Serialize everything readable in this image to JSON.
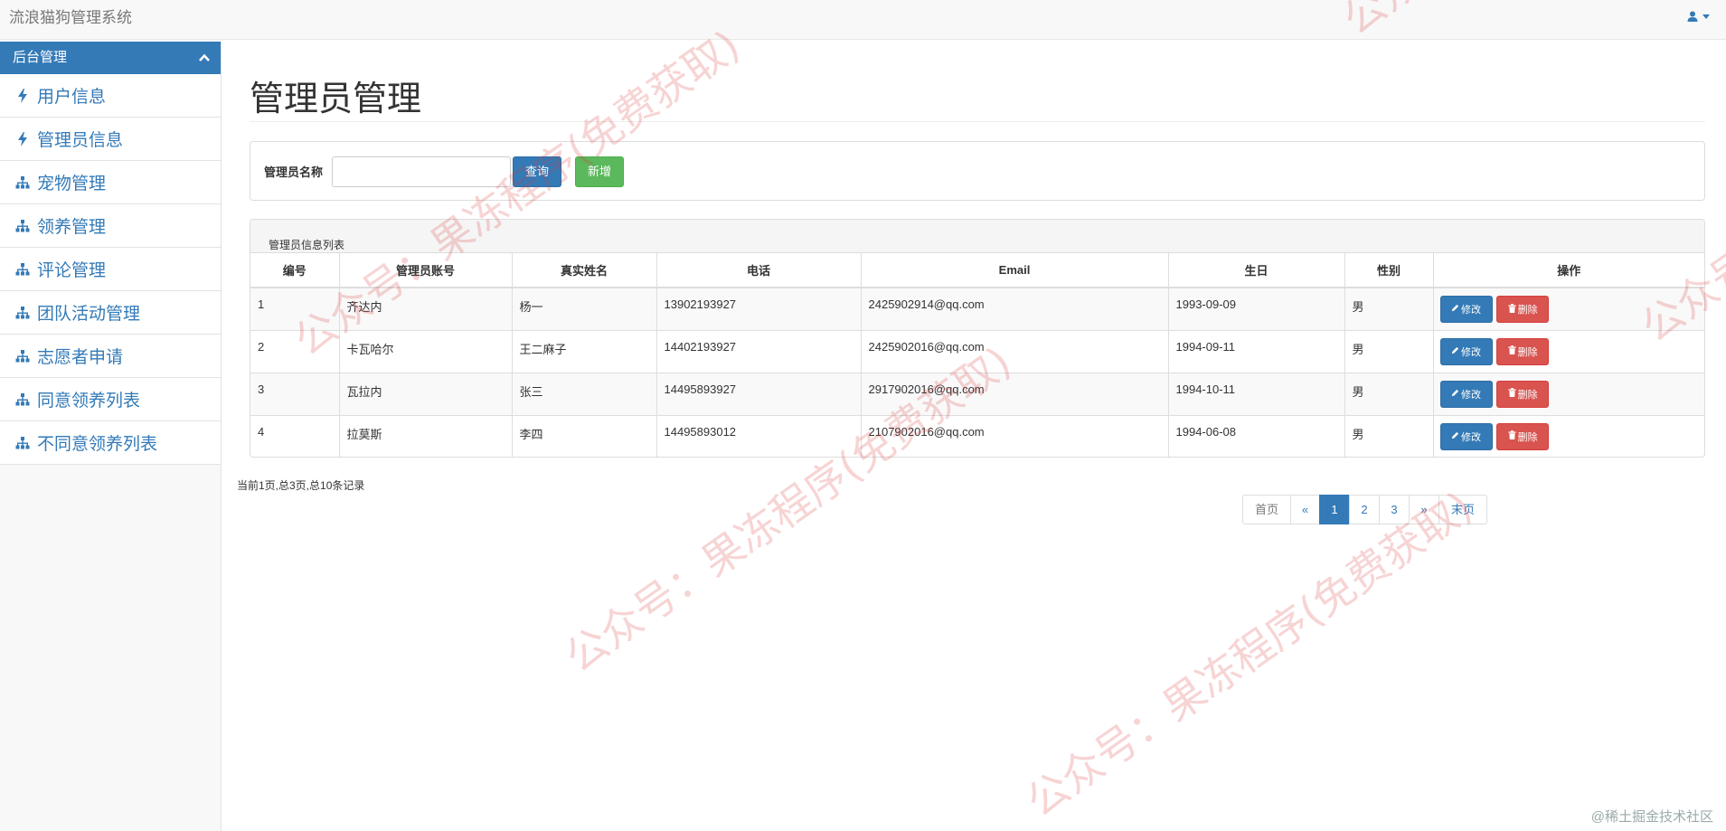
{
  "navbar": {
    "brand": "流浪猫狗管理系统",
    "user_icon": "user-icon"
  },
  "sidebar": {
    "header": "后台管理",
    "items": [
      {
        "label": "用户信息",
        "icon": "bolt-icon"
      },
      {
        "label": "管理员信息",
        "icon": "bolt-icon"
      },
      {
        "label": "宠物管理",
        "icon": "sitemap-icon"
      },
      {
        "label": "领养管理",
        "icon": "sitemap-icon"
      },
      {
        "label": "评论管理",
        "icon": "sitemap-icon"
      },
      {
        "label": "团队活动管理",
        "icon": "sitemap-icon"
      },
      {
        "label": "志愿者申请",
        "icon": "sitemap-icon"
      },
      {
        "label": "同意领养列表",
        "icon": "sitemap-icon"
      },
      {
        "label": "不同意领养列表",
        "icon": "sitemap-icon"
      }
    ]
  },
  "main": {
    "title": "管理员管理",
    "search": {
      "label": "管理员名称",
      "value": "",
      "query_label": "查询",
      "add_label": "新增"
    },
    "table": {
      "heading": "管理员信息列表",
      "columns": [
        "编号",
        "管理员账号",
        "真实姓名",
        "电话",
        "Email",
        "生日",
        "性别",
        "操作"
      ],
      "rows": [
        {
          "id": "1",
          "account": "齐达内",
          "name": "杨一",
          "phone": "13902193927",
          "email": "2425902914@qq.com",
          "birthday": "1993-09-09",
          "gender": "男"
        },
        {
          "id": "2",
          "account": "卡瓦哈尔",
          "name": "王二麻子",
          "phone": "14402193927",
          "email": "2425902016@qq.com",
          "birthday": "1994-09-11",
          "gender": "男"
        },
        {
          "id": "3",
          "account": "瓦拉内",
          "name": "张三",
          "phone": "14495893927",
          "email": "2917902016@qq.com",
          "birthday": "1994-10-11",
          "gender": "男"
        },
        {
          "id": "4",
          "account": "拉莫斯",
          "name": "李四",
          "phone": "14495893012",
          "email": "2107902016@qq.com",
          "birthday": "1994-06-08",
          "gender": "男"
        }
      ],
      "edit_label": "修改",
      "delete_label": "删除"
    },
    "page_info": "当前1页,总3页,总10条记录",
    "pagination": {
      "first": "首页",
      "prev": "«",
      "pages": [
        "1",
        "2",
        "3"
      ],
      "current": "1",
      "next": "»",
      "last": "末页"
    }
  },
  "watermark": {
    "text": "公众号：果冻程序(免费获取)",
    "corner": "@稀土掘金技术社区"
  },
  "colors": {
    "primary": "#337ab7",
    "success": "#5cb85c",
    "danger": "#d9534f"
  }
}
